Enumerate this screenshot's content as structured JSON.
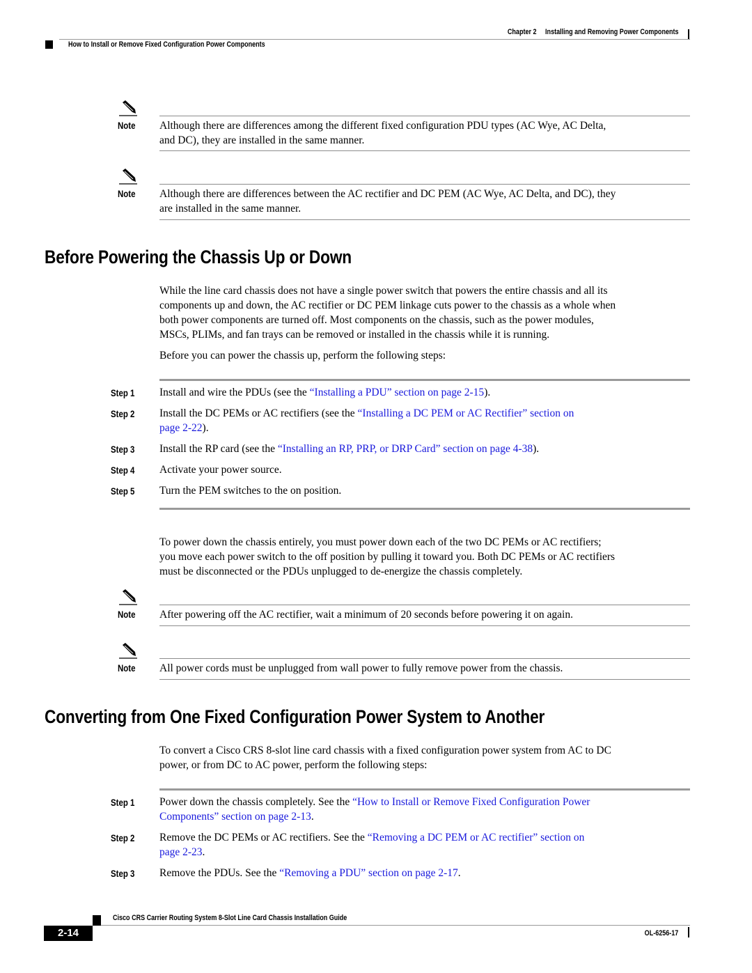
{
  "header": {
    "chapter_label": "Chapter 2",
    "chapter_title": "Installing and Removing Power Components",
    "section_title": "How to Install or Remove Fixed Configuration Power Components"
  },
  "notes_top": [
    {
      "label": "Note",
      "icon": "pencil-note-icon",
      "lines": [
        "Although there are differences among the different fixed configuration PDU types (AC Wye, AC Delta,",
        "and DC), they are installed in the same manner."
      ]
    },
    {
      "label": "Note",
      "icon": "pencil-note-icon",
      "lines": [
        "Although there are differences between the AC rectifier and DC PEM (AC Wye, AC Delta, and DC), they",
        "are installed in the same manner."
      ]
    }
  ],
  "section1": {
    "heading": "Before Powering the Chassis Up or Down",
    "paragraph_lines": [
      "While the line card chassis does not have a single power switch that powers the entire chassis and all its",
      "components up and down, the AC rectifier or DC PEM linkage cuts power to the chassis as a whole when",
      "both power components are turned off. Most components on the chassis, such as the power modules,",
      "MSCs, PLIMs, and fan trays can be removed or installed in the chassis while it is running."
    ],
    "intro": "Before you can power the chassis up, perform the following steps:",
    "steps": [
      {
        "label": "Step 1",
        "line1": {
          "pre": "Install and wire the PDUs (see the ",
          "link": "“Installing a PDU” section on page 2-15",
          "post": ")."
        }
      },
      {
        "label": "Step 2",
        "line1": {
          "pre": "Install the DC PEMs or AC rectifiers (see the ",
          "link": "“Installing a DC PEM or AC Rectifier” section on",
          "post": ""
        },
        "line2": {
          "pre": "",
          "link": "page 2-22",
          "post": ")."
        }
      },
      {
        "label": "Step 3",
        "line1": {
          "pre": "Install the RP card (see the ",
          "link": "“Installing an RP, PRP, or DRP Card” section on page 4-38",
          "post": ")."
        }
      },
      {
        "label": "Step 4",
        "line1": {
          "pre": "Activate your power source.",
          "link": "",
          "post": ""
        }
      },
      {
        "label": "Step 5",
        "line1": {
          "pre": "Turn the PEM switches to the on position.",
          "link": "",
          "post": ""
        }
      }
    ],
    "powerdown_lines": [
      "To power down the chassis entirely, you must power down each of the two DC PEMs or AC rectifiers;",
      "you move each power switch to the off position by pulling it toward you. Both DC PEMs or AC rectifiers",
      "must be disconnected or the PDUs unplugged to de-energize the chassis completely."
    ],
    "notes": [
      {
        "label": "Note",
        "icon": "pencil-note-icon",
        "text": "After powering off the AC rectifier, wait a minimum of 20 seconds before powering it on again."
      },
      {
        "label": "Note",
        "icon": "pencil-note-icon",
        "text": "All power cords must be unplugged from wall power to fully remove power from the chassis."
      }
    ]
  },
  "section2": {
    "heading": "Converting from One Fixed Configuration Power System to Another",
    "paragraph_lines": [
      "To convert a Cisco CRS 8-slot line card chassis with a fixed configuration power system from AC to DC",
      "power, or from DC to AC power, perform the following steps:"
    ],
    "steps": [
      {
        "label": "Step 1",
        "line1": {
          "pre": "Power down the chassis completely. See the ",
          "link": "“How to Install or Remove Fixed Configuration Power",
          "post": ""
        },
        "line2": {
          "pre": "",
          "link": "Components” section on page 2-13",
          "post": "."
        }
      },
      {
        "label": "Step 2",
        "line1": {
          "pre": "Remove the DC PEMs or AC rectifiers. See the ",
          "link": "“Removing a DC PEM or AC rectifier” section on",
          "post": ""
        },
        "line2": {
          "pre": "",
          "link": "page 2-23",
          "post": "."
        }
      },
      {
        "label": "Step 3",
        "line1": {
          "pre": "Remove the PDUs. See the ",
          "link": "“Removing a PDU” section on page 2-17",
          "post": "."
        }
      }
    ]
  },
  "footer": {
    "guide_title": "Cisco CRS Carrier Routing System 8-Slot Line Card Chassis Installation Guide",
    "page_number": "2-14",
    "doc_number": "OL-6256-17"
  },
  "colors": {
    "link": "#1a1adc",
    "rule": "#8c8c8c",
    "text": "#000000"
  }
}
